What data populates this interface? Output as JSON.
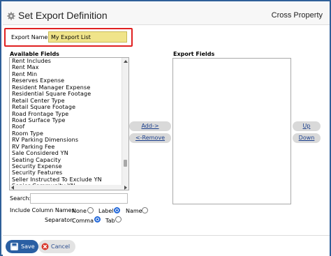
{
  "window": {
    "title": "Set Export Definition",
    "context": "Cross Property",
    "icon": "gear-icon"
  },
  "export_name": {
    "label": "Export Name:",
    "value": "My Export List"
  },
  "available_fields": {
    "label": "Available Fields",
    "items": [
      "Rent Includes",
      "Rent Max",
      "Rent Min",
      "Reserves Expense",
      "Resident Manager Expense",
      "Residential Square Footage",
      "Retail Center Type",
      "Retail Square Footage",
      "Road Frontage Type",
      "Road Surface Type",
      "Roof",
      "Room Type",
      "RV Parking Dimensions",
      "RV Parking Fee",
      "Sale Considered YN",
      "Seating Capacity",
      "Security Expense",
      "Security Features",
      "Seller Instructed To Exclude YN",
      "Senior Community YN"
    ]
  },
  "export_fields": {
    "label": "Export Fields",
    "items": []
  },
  "buttons": {
    "add": "Add->",
    "remove": "<-Remove",
    "up": "Up",
    "down": "Down",
    "save": "Save",
    "cancel": "Cancel"
  },
  "search": {
    "label": "Search:",
    "value": ""
  },
  "include_column_names": {
    "label": "Include Column Names:",
    "options": [
      "None",
      "Label",
      "Name"
    ],
    "selected": "Label"
  },
  "separator": {
    "label": "Separator:",
    "options": [
      "Comma",
      "Tab"
    ],
    "selected": "Comma"
  },
  "colors": {
    "frame_border": "#2f5f98",
    "highlight_border": "#e02020",
    "name_input_bg": "#f0e48a",
    "save_button": "#2a5fa3",
    "link_text": "#1a3e8c",
    "radio_checked": "#1f66d9"
  }
}
